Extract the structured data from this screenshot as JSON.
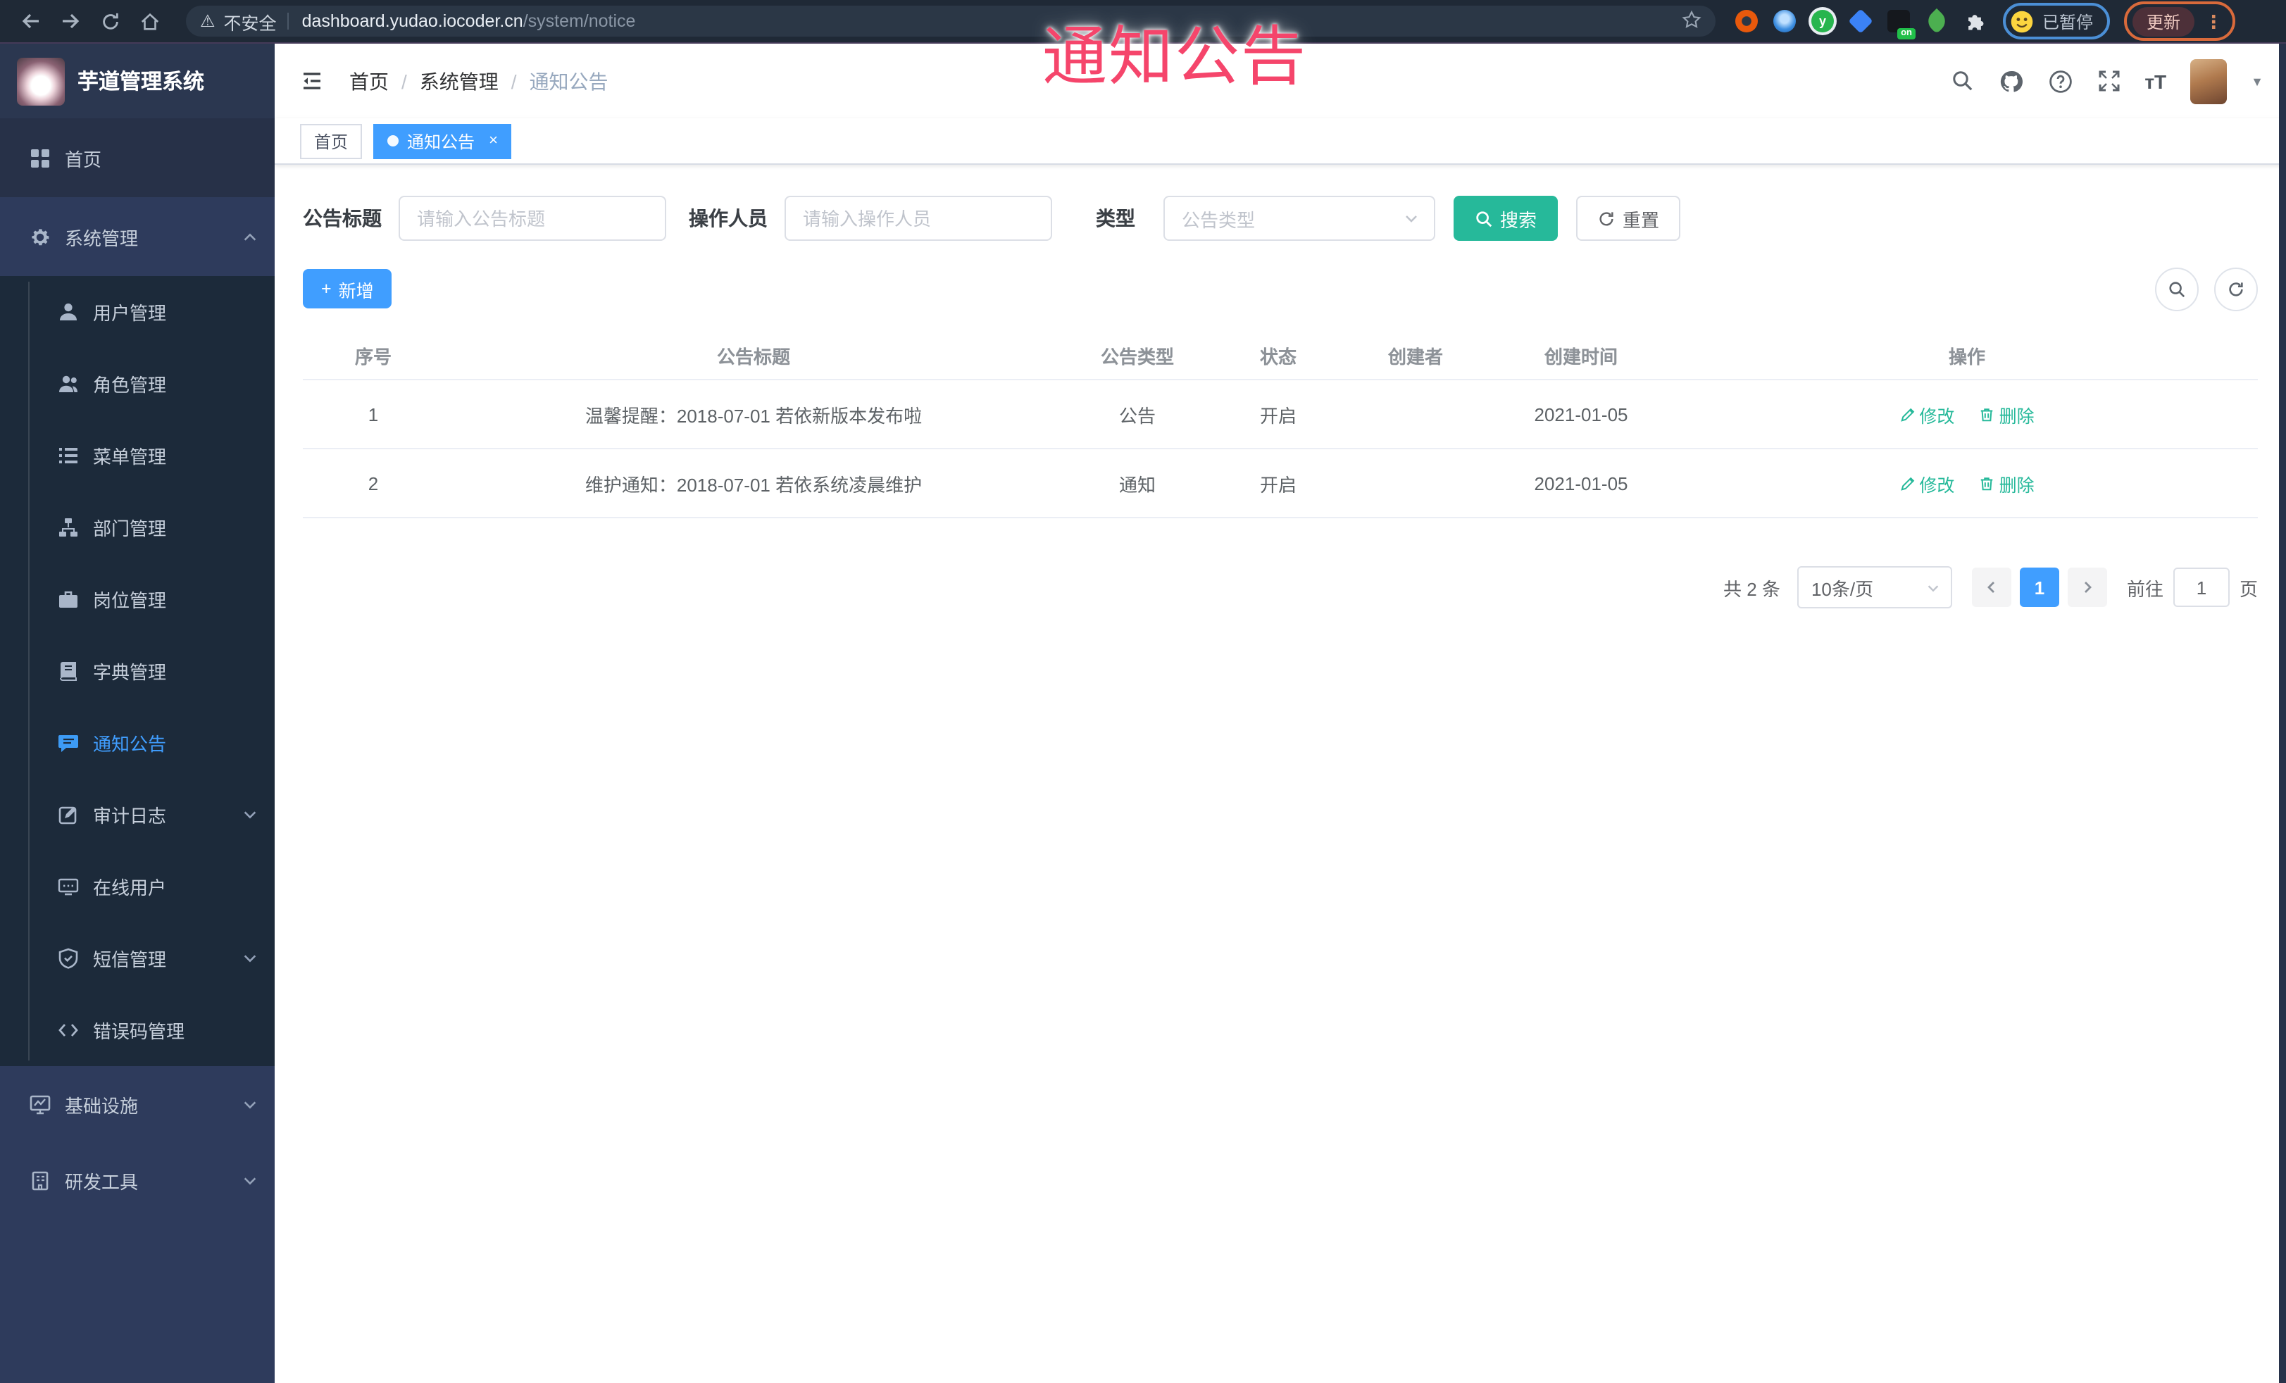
{
  "annotation": {
    "text": "通知公告"
  },
  "browser": {
    "security_label": "不安全",
    "url_host": "dashboard.yudao.iocoder.cn",
    "url_path": "/system/notice",
    "extension_on_badge": "on",
    "paused_label": "已暂停",
    "update_label": "更新"
  },
  "sidebar": {
    "logo_title": "芋道管理系统",
    "top_items": [
      {
        "label": "首页"
      },
      {
        "label": "系统管理"
      }
    ],
    "sub_items": [
      {
        "label": "用户管理"
      },
      {
        "label": "角色管理"
      },
      {
        "label": "菜单管理"
      },
      {
        "label": "部门管理"
      },
      {
        "label": "岗位管理"
      },
      {
        "label": "字典管理"
      },
      {
        "label": "通知公告"
      },
      {
        "label": "审计日志"
      },
      {
        "label": "在线用户"
      },
      {
        "label": "短信管理"
      },
      {
        "label": "错误码管理"
      }
    ],
    "bottom_items": [
      {
        "label": "基础设施"
      },
      {
        "label": "研发工具"
      }
    ]
  },
  "header": {
    "breadcrumb": [
      "首页",
      "系统管理",
      "通知公告"
    ]
  },
  "tabs": [
    {
      "label": "首页"
    },
    {
      "label": "通知公告"
    }
  ],
  "filters": {
    "title_label": "公告标题",
    "title_placeholder": "请输入公告标题",
    "operator_label": "操作人员",
    "operator_placeholder": "请输入操作人员",
    "type_label": "类型",
    "type_placeholder": "公告类型",
    "search_label": "搜索",
    "reset_label": "重置"
  },
  "toolbar": {
    "add_label": "新增"
  },
  "table": {
    "headers": [
      "序号",
      "公告标题",
      "公告类型",
      "状态",
      "创建者",
      "创建时间",
      "操作"
    ],
    "actions": {
      "edit": "修改",
      "delete": "删除"
    },
    "rows": [
      {
        "no": "1",
        "title": "温馨提醒：2018-07-01 若依新版本发布啦",
        "type": "公告",
        "status": "开启",
        "creator": "",
        "created": "2021-01-05"
      },
      {
        "no": "2",
        "title": "维护通知：2018-07-01 若依系统凌晨维护",
        "type": "通知",
        "status": "开启",
        "creator": "",
        "created": "2021-01-05"
      }
    ]
  },
  "pagination": {
    "total": "共 2 条",
    "page_size": "10条/页",
    "page": "1",
    "goto_label": "前往",
    "goto_value": "1",
    "unit": "页"
  },
  "colors": {
    "primary": "#409eff",
    "teal": "#26b99a",
    "annotation": "#f5456b"
  }
}
